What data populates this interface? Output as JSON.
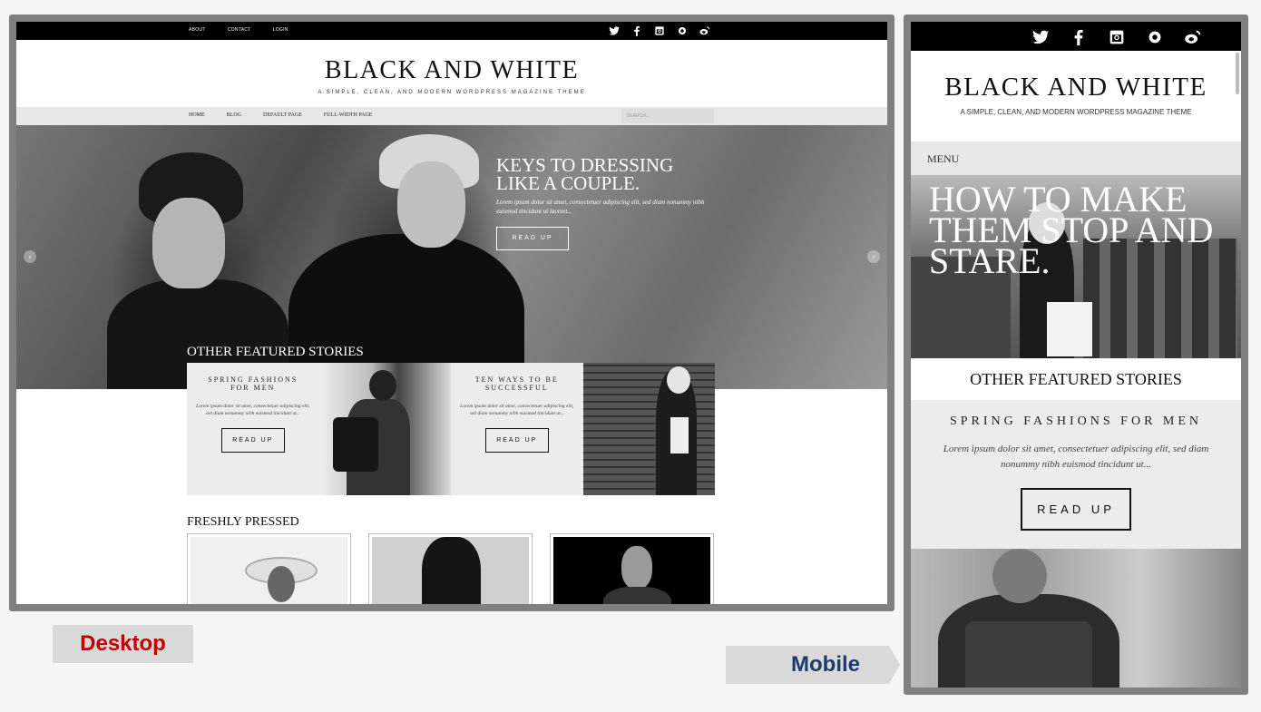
{
  "desktop": {
    "top_nav": [
      "ABOUT",
      "CONTACT",
      "LOGIN"
    ],
    "social_icons": [
      "twitter-icon",
      "facebook-icon",
      "instagram-icon",
      "circle-icon",
      "weibo-icon"
    ],
    "site_title": "BLACK AND WHITE",
    "tagline": "A SIMPLE, CLEAN, AND MODERN WORDPRESS MAGAZINE THEME",
    "main_nav": [
      "HOME",
      "BLOG",
      "DEFAULT PAGE",
      "FULL-WIDTH PAGE"
    ],
    "search_placeholder": "SEARCH...",
    "hero": {
      "title": "KEYS TO DRESSING LIKE A COUPLE.",
      "excerpt": "Lorem ipsum dolor sit amet, consectetuer adipiscing elit, sed diam nonummy nibh euismod tincidunt ut laoreet...",
      "button": "READ UP",
      "prev_arrow": "‹",
      "next_arrow": "›"
    },
    "other_featured_title": "OTHER FEATURED STORIES",
    "featured": [
      {
        "title": "SPRING FASHIONS FOR MEN",
        "excerpt": "Lorem ipsum dolor sit amet, consectetuer adipiscing elit, sed diam nonummy nibh euismod tincidunt ut...",
        "button": "READ UP"
      },
      {
        "title": "TEN WAYS TO BE SUCCESSFUL",
        "excerpt": "Lorem ipsum dolor sit amet, consectetuer adipiscing elit, sed diam nonummy nibh euismod tincidunt ut...",
        "button": "READ UP"
      }
    ],
    "freshly_pressed_title": "FRESHLY PRESSED"
  },
  "mobile": {
    "social_icons": [
      "twitter-icon",
      "facebook-icon",
      "instagram-icon",
      "circle-icon",
      "weibo-icon"
    ],
    "site_title": "BLACK AND WHITE",
    "tagline": "A SIMPLE, CLEAN, AND MODERN WORDPRESS MAGAZINE THEME",
    "menu_label": "MENU",
    "hero_title": "HOW TO MAKE THEM STOP AND STARE.",
    "other_featured_title": "OTHER FEATURED STORIES",
    "featured": {
      "title": "SPRING FASHIONS FOR MEN",
      "excerpt": "Lorem ipsum dolor sit amet, consectetuer adipiscing elit, sed diam nonummy nibh euismod tincidunt ut...",
      "button": "READ UP"
    }
  },
  "labels": {
    "desktop": "Desktop",
    "mobile": "Mobile"
  },
  "colors": {
    "desktop_label": "#c00000",
    "mobile_label": "#1f3a6e",
    "frame": "#808080",
    "topbar": "#000000",
    "nav_bar": "#e8e8e8"
  }
}
